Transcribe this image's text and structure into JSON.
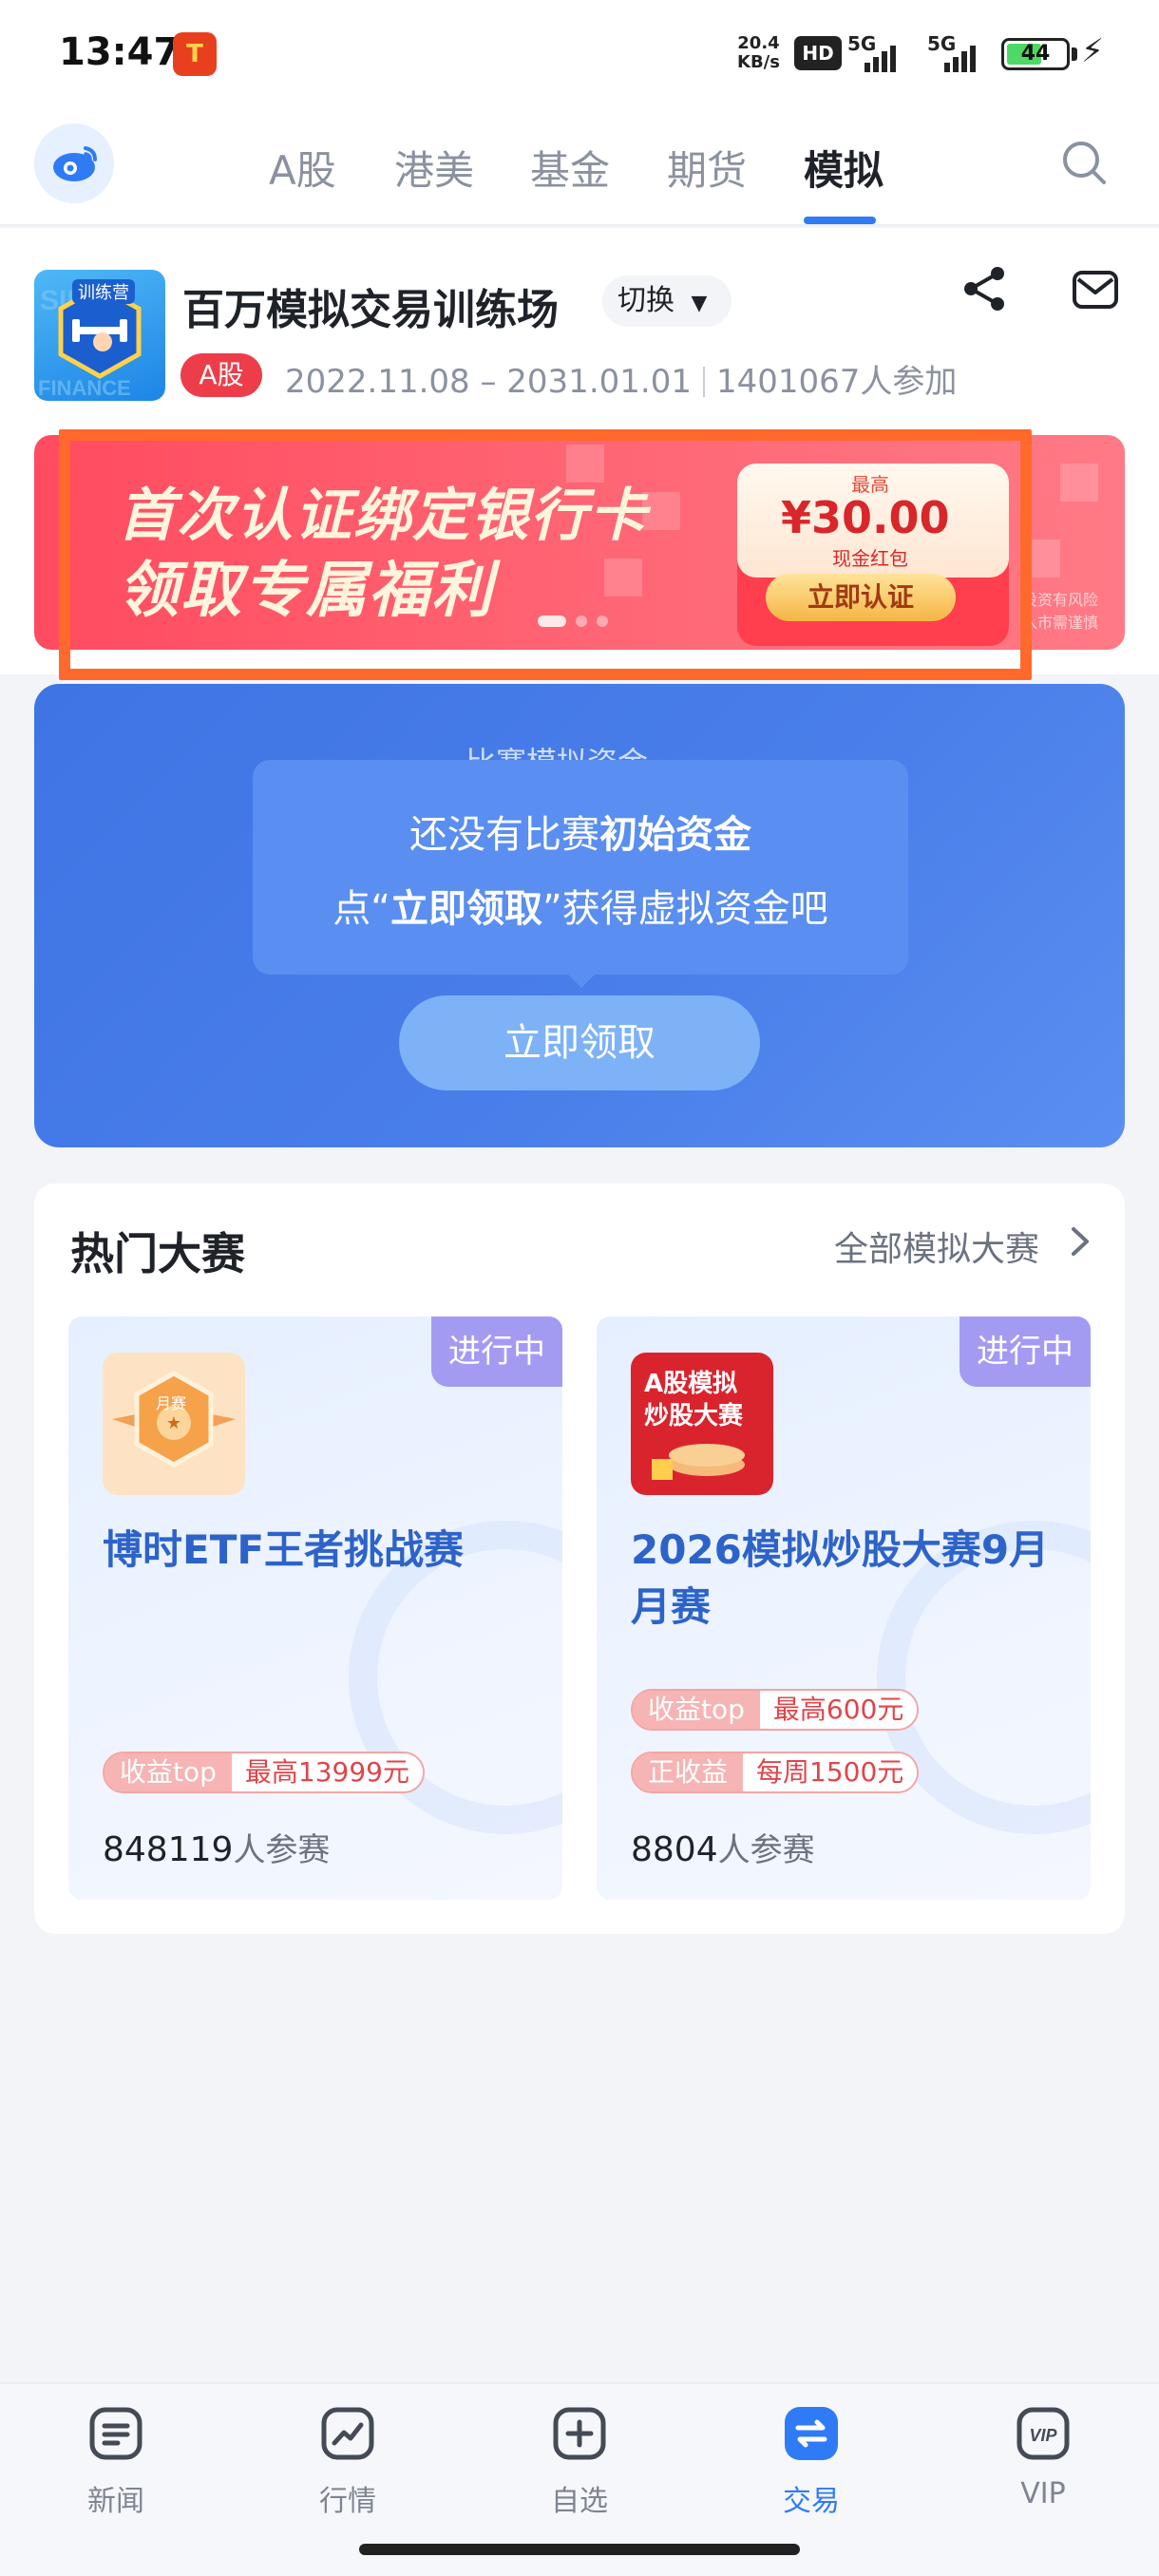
{
  "status_bar": {
    "time": "13:47",
    "net_speed_value": "20.4",
    "net_speed_unit": "KB/s",
    "hd": "HD",
    "sim1": "5G",
    "sim2": "5G",
    "battery": "44"
  },
  "top_nav": {
    "tabs": [
      "A股",
      "港美",
      "基金",
      "期货",
      "模拟"
    ],
    "active_tab": "模拟"
  },
  "contest": {
    "title": "百万模拟交易训练场",
    "switch_label": "切换",
    "market_badge": "A股",
    "date_range": "2022.11.08 – 2031.01.01",
    "participants": "1401067人参加",
    "logo_text": "训练营"
  },
  "banner": {
    "line1": "首次认证绑定银行卡",
    "line2": "领取专属福利",
    "packet_top": "最高",
    "amount": "¥30.00",
    "packet_sub": "现金红包",
    "cta": "立即认证",
    "risk_line1": "投资有风险",
    "risk_line2": "入市需谨慎"
  },
  "fund_card": {
    "behind_text": "比赛模拟资金",
    "tip_line1_a": "还没有比赛",
    "tip_line1_b": "初始资金",
    "tip_line2_a": "点“",
    "tip_line2_b": "立即领取",
    "tip_line2_c": "”获得虚拟资金吧",
    "button": "立即领取"
  },
  "hot": {
    "title": "热门大赛",
    "all_link": "全部模拟大赛",
    "cards": [
      {
        "badge": "进行中",
        "icon_text": "月赛",
        "name": "博时ETF王者挑战赛",
        "tags": [
          {
            "label": "收益top",
            "value": "最高13999元"
          }
        ],
        "count": "848119",
        "count_unit": "人参赛"
      },
      {
        "badge": "进行中",
        "icon_text_1": "A股模拟",
        "icon_text_2": "炒股大赛",
        "name": "2026模拟炒股大赛9月月赛",
        "tags": [
          {
            "label": "收益top",
            "value": "最高600元"
          },
          {
            "label": "正收益",
            "value": "每周1500元"
          }
        ],
        "count": "8804",
        "count_unit": "人参赛"
      }
    ]
  },
  "bottom_nav": {
    "items": [
      {
        "label": "新闻",
        "icon": "news-icon"
      },
      {
        "label": "行情",
        "icon": "chart-icon"
      },
      {
        "label": "自选",
        "icon": "plus-box-icon"
      },
      {
        "label": "交易",
        "icon": "exchange-icon"
      },
      {
        "label": "VIP",
        "icon": "vip-icon"
      }
    ],
    "active": "交易"
  },
  "colors": {
    "accent": "#2f7bf5",
    "badge_red": "#ee3d4a",
    "fund_blue": "#4a7fea",
    "card_title": "#2d63c9"
  }
}
